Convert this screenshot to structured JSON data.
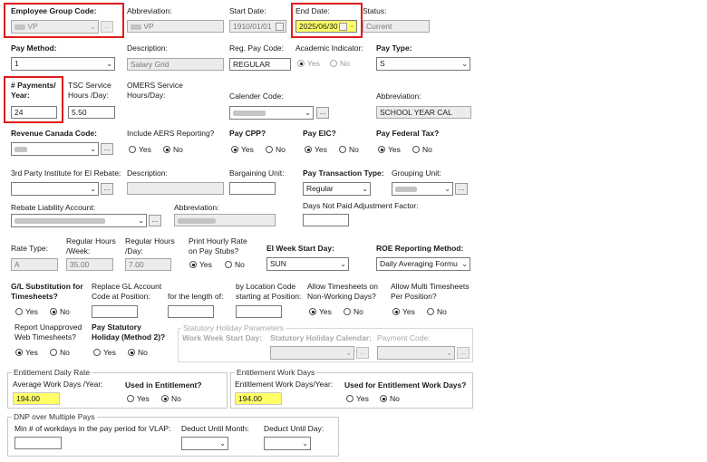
{
  "header": {
    "employee_group_code_label": "Employee Group Code:",
    "employee_group_code_value": "VP",
    "abbreviation_label": "Abbreviation:",
    "abbreviation_value": "VP",
    "start_date_label": "Start Date:",
    "start_date_value": "1910/01/01",
    "end_date_label": "End Date:",
    "end_date_value": "2025/06/30",
    "status_label": "Status:",
    "status_value": "Current"
  },
  "row2": {
    "pay_method_label": "Pay Method:",
    "pay_method_value": "1",
    "description_label": "Description:",
    "description_value": "Salary Grid",
    "reg_pay_code_label": "Reg. Pay Code:",
    "reg_pay_code_value": "REGULAR",
    "academic_indicator_label": "Academic Indicator:",
    "yes": "Yes",
    "no": "No",
    "pay_type_label": "Pay Type:",
    "pay_type_value": "S"
  },
  "row3": {
    "payments_year_label": "# Payments/ Year:",
    "payments_year_value": "24",
    "tsc_label": "TSC Service Hours /Day:",
    "tsc_value": "5.50",
    "omers_label": "OMERS Service Hours/Day:",
    "calendar_code_label": "Calender Code:",
    "abbreviation_label": "Abbreviation:",
    "abbreviation_value": "SCHOOL YEAR CAL"
  },
  "row4": {
    "revenue_canada_label": "Revenue Canada Code:",
    "include_aers_label": "Include AERS Reporting?",
    "pay_cpp_label": "Pay CPP?",
    "pay_eic_label": "Pay EIC?",
    "pay_fed_tax_label": "Pay Federal Tax?"
  },
  "row5": {
    "third_party_label": "3rd Party Institute for EI Rebate:",
    "description_label": "Description:",
    "bargaining_unit_label": "Bargaining Unit:",
    "pay_transaction_type_label": "Pay Transaction Type:",
    "pay_transaction_type_value": "Regular",
    "grouping_unit_label": "Grouping Unit:"
  },
  "row6": {
    "rebate_liability_label": "Rebate Liability Account:",
    "abbreviation_label": "Abbreviation:",
    "days_not_paid_label": "Days Not Paid Adjustment Factor:"
  },
  "row7": {
    "rate_type_label": "Rate Type:",
    "rate_type_value": "A",
    "regular_hours_week_label": "Regular Hours /Week:",
    "regular_hours_week_value": "35.00",
    "regular_hours_day_label": "Regular Hours /Day:",
    "regular_hours_day_value": "7.00",
    "print_hourly_label": "Print Hourly Rate on Pay Stubs?",
    "ei_week_start_label": "EI Week Start Day:",
    "ei_week_start_value": "SUN",
    "roe_method_label": "ROE Reporting Method:",
    "roe_method_value": "Daily Averaging Formu"
  },
  "row8": {
    "gl_substitution_label": "G/L Substitution for Timesheets?",
    "replace_gl_label": "Replace GL Account Code at Position:",
    "length_label": "for the length of:",
    "by_location_label": "by Location Code starting at Position:",
    "allow_non_working_label": "Allow Timesheets on Non-Working Days?",
    "allow_multi_label": "Allow Multi Timesheets Per Position?"
  },
  "row9": {
    "report_unapproved_label": "Report Unapproved Web Timesheets?",
    "pay_statutory_label": "Pay Statutory Holiday (Method 2)?",
    "stat_group_title": "Statutory Holiday Parameters",
    "work_week_start_label": "Work Week Start Day:",
    "stat_calendar_label": "Statutory Holiday Calendar:",
    "payment_code_label": "Payment Code:"
  },
  "entitlement_daily": {
    "group_title": "Entitlement Daily Rate",
    "avg_work_days_label": "Average Work Days /Year:",
    "avg_work_days_value": "194.00",
    "used_label": "Used in Entitlement?"
  },
  "entitlement_work": {
    "group_title": "Entitlement Work Days",
    "work_days_label": "Entitlement Work Days/Year:",
    "work_days_value": "194.00",
    "used_label": "Used for Entitlement Work Days?"
  },
  "dnp": {
    "group_title": "DNP over Multiple Pays",
    "min_workdays_label": "Min # of workdays in the pay period for VLAP:",
    "deduct_month_label": "Deduct Until Month:",
    "deduct_day_label": "Deduct Until Day:"
  },
  "icons": {
    "dropdown": "chevron-down-icon",
    "lookup": "ellipsis-icon",
    "calendar": "calendar-icon"
  },
  "colors": {
    "highlight_box": "#e01b1b",
    "highlight_fill": "#ffff66"
  }
}
